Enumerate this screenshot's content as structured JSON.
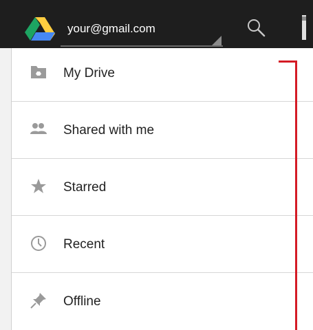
{
  "app": {
    "account": "your@gmail.com"
  },
  "icons": {
    "logo": "google-drive-logo",
    "search": "search-icon",
    "overflow": "overflow-menu-icon"
  },
  "drawer": {
    "items": [
      {
        "label": "My Drive",
        "icon": "folder-drive-icon"
      },
      {
        "label": "Shared with me",
        "icon": "people-icon"
      },
      {
        "label": "Starred",
        "icon": "star-icon"
      },
      {
        "label": "Recent",
        "icon": "clock-icon"
      },
      {
        "label": "Offline",
        "icon": "pin-icon"
      }
    ]
  },
  "colors": {
    "topbar": "#1e1e1e",
    "callout": "#d41b25",
    "drive_green": "#1da462",
    "drive_yellow": "#ffcd40",
    "drive_blue": "#4688f4"
  }
}
